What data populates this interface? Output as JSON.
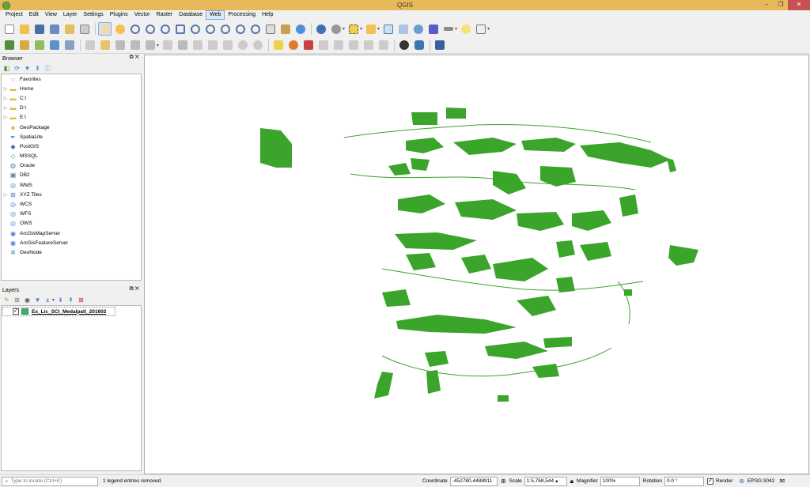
{
  "window": {
    "title": "QGIS",
    "minimize": "–",
    "maximize": "❐",
    "close": "✕"
  },
  "menubar": [
    "Project",
    "Edit",
    "View",
    "Layer",
    "Settings",
    "Plugins",
    "Vector",
    "Raster",
    "Database",
    "Web",
    "Processing",
    "Help"
  ],
  "browser": {
    "title": "Browser",
    "items": [
      {
        "label": "Favorites",
        "icon": "star-icon",
        "expand": false
      },
      {
        "label": "Home",
        "icon": "folder-icon",
        "expand": true
      },
      {
        "label": "C:\\",
        "icon": "folder-icon",
        "expand": true
      },
      {
        "label": "D:\\",
        "icon": "folder-icon",
        "expand": true
      },
      {
        "label": "E:\\",
        "icon": "folder-icon",
        "expand": true
      },
      {
        "label": "GeoPackage",
        "icon": "geopackage-icon",
        "expand": false
      },
      {
        "label": "SpatiaLite",
        "icon": "spatialite-icon",
        "expand": false
      },
      {
        "label": "PostGIS",
        "icon": "postgis-icon",
        "expand": false
      },
      {
        "label": "MSSQL",
        "icon": "mssql-icon",
        "expand": false
      },
      {
        "label": "Oracle",
        "icon": "oracle-icon",
        "expand": false
      },
      {
        "label": "DB2",
        "icon": "db2-icon",
        "expand": false
      },
      {
        "label": "WMS",
        "icon": "globe-icon",
        "expand": false
      },
      {
        "label": "XYZ Tiles",
        "icon": "grid-icon",
        "expand": true
      },
      {
        "label": "WCS",
        "icon": "globe-icon",
        "expand": false
      },
      {
        "label": "WFS",
        "icon": "globe-icon",
        "expand": false
      },
      {
        "label": "OWS",
        "icon": "globe-icon",
        "expand": false
      },
      {
        "label": "ArcGisMapServer",
        "icon": "arcgis-icon",
        "expand": false
      },
      {
        "label": "ArcGisFeatureServer",
        "icon": "arcgis-icon",
        "expand": false
      },
      {
        "label": "GeoNode",
        "icon": "geonode-icon",
        "expand": false
      }
    ]
  },
  "layers": {
    "title": "Layers",
    "items": [
      {
        "name": "Es_Lic_SCI_Medalpatl_201602",
        "checked": true,
        "color": "#3dab72"
      }
    ]
  },
  "status": {
    "locate_placeholder": "Type to locate (Ctrl+K)",
    "message": "1 legend entries removed.",
    "coordinate_label": "Coordinate",
    "coordinate": "-452780,4488911",
    "scale_label": "Scale",
    "scale": "1:5,768,544",
    "magnifier_label": "Magnifier",
    "magnifier": "100%",
    "rotation_label": "Rotation",
    "rotation": "0.0 °",
    "render_label": "Render",
    "render_checked": true,
    "crs": "EPSG:3042"
  },
  "colors": {
    "map_fill": "#3aa52a",
    "titlebar": "#e8b95a"
  }
}
